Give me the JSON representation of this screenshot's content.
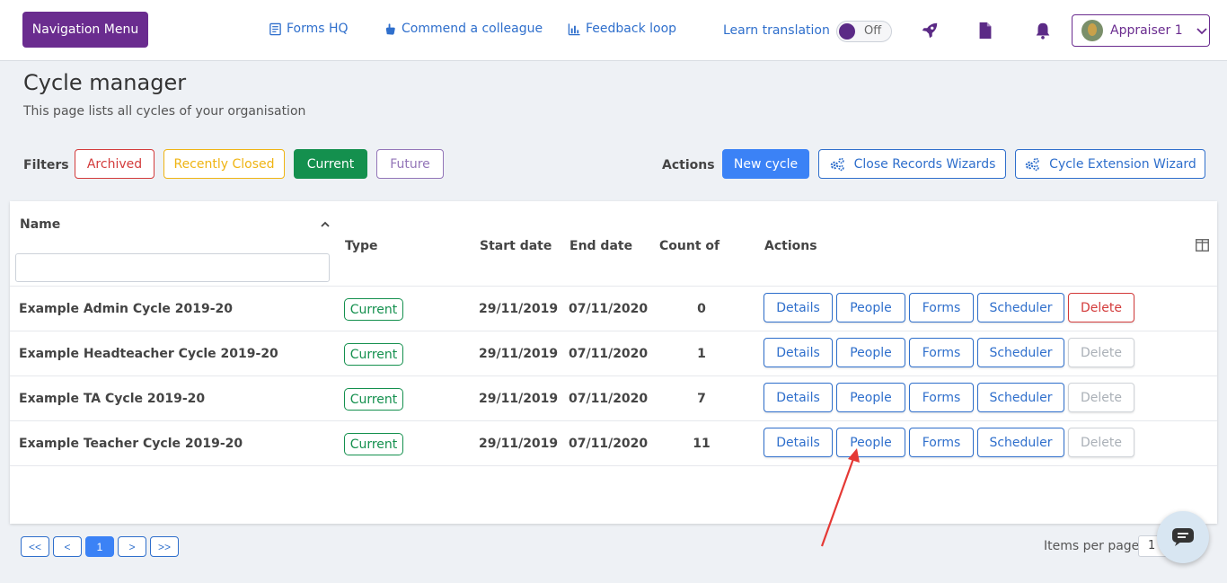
{
  "topbar": {
    "nav_menu_label": "Navigation Menu",
    "links": [
      "Forms HQ",
      "Commend a colleague",
      "Feedback loop"
    ],
    "learn_translation": "Learn translation",
    "toggle_state": "Off",
    "user_label": "Appraiser 1",
    "icons": [
      "rocket-icon",
      "document-icon",
      "bell-icon"
    ]
  },
  "header": {
    "title": "Cycle manager",
    "subtitle": "This page lists all cycles of your organisation"
  },
  "filters": {
    "label": "Filters",
    "items": [
      "Archived",
      "Recently Closed",
      "Current",
      "Future"
    ],
    "selected": "Current"
  },
  "actions": {
    "label": "Actions",
    "new_cycle": "New cycle",
    "close_records": "Close Records Wizards",
    "cycle_extension": "Cycle Extension Wizard"
  },
  "table": {
    "headers": {
      "name": "Name",
      "type": "Type",
      "start": "Start date",
      "end": "End date",
      "count": "Count of",
      "actions": "Actions"
    },
    "name_filter_value": "",
    "rows": [
      {
        "name": "Example Admin Cycle 2019-20",
        "type": "Current",
        "start": "29/11/2019",
        "end": "07/11/2020",
        "count": "0"
      },
      {
        "name": "Example Headteacher Cycle 2019-20",
        "type": "Current",
        "start": "29/11/2019",
        "end": "07/11/2020",
        "count": "1"
      },
      {
        "name": "Example TA Cycle 2019-20",
        "type": "Current",
        "start": "29/11/2019",
        "end": "07/11/2020",
        "count": "7"
      },
      {
        "name": "Example Teacher Cycle 2019-20",
        "type": "Current",
        "start": "29/11/2019",
        "end": "07/11/2020",
        "count": "11"
      }
    ],
    "row_buttons": {
      "details": "Details",
      "people": "People",
      "forms": "Forms",
      "scheduler": "Scheduler",
      "delete": "Delete"
    }
  },
  "pagination": {
    "first": "<<",
    "prev": "<",
    "current": "1",
    "next": ">",
    "last": ">>",
    "items_per_page_label": "Items per page",
    "items_per_page_value": "1"
  },
  "colors": {
    "brand_purple": "#6a2c8f",
    "link_blue": "#2f6fcc",
    "primary_blue": "#3b82f6",
    "success_green": "#14904e",
    "danger_red": "#d33b3b",
    "warning_yellow": "#efb413",
    "annotation_arrow": "#e53935"
  }
}
